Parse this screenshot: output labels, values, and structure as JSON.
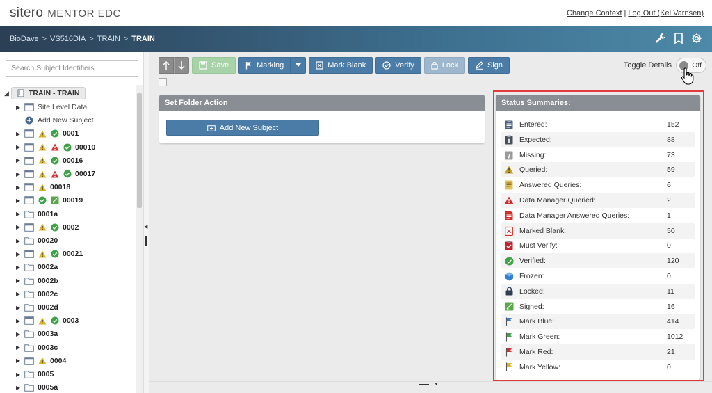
{
  "header": {
    "logo_text": "sitero",
    "logo_sub": "MENTOR EDC",
    "links": [
      "Change Context",
      "Log Out (Kel Varnsen)"
    ],
    "separator": "|"
  },
  "breadcrumb": {
    "items": [
      "BioDave",
      "VS516DIA",
      "TRAIN"
    ],
    "current": "TRAIN",
    "separator": ">"
  },
  "nav_icons": [
    "wrench-icon",
    "bookmark-icon",
    "gear-icon"
  ],
  "sidebar": {
    "search_placeholder": "Search Subject Identifiers",
    "root_label": "TRAIN - TRAIN",
    "items": [
      {
        "label": "Site Level Data",
        "icon": "page",
        "statuses": [],
        "bold": false,
        "caret": true
      },
      {
        "label": "Add New Subject",
        "icon": "plus",
        "statuses": [],
        "bold": false,
        "caret": false
      },
      {
        "label": "0001",
        "icon": "page",
        "statuses": [
          "warn",
          "ok"
        ],
        "bold": true,
        "caret": true
      },
      {
        "label": "00010",
        "icon": "page",
        "statuses": [
          "warn",
          "dm",
          "ok"
        ],
        "bold": true,
        "caret": true
      },
      {
        "label": "00016",
        "icon": "page",
        "statuses": [
          "warn",
          "ok"
        ],
        "bold": true,
        "caret": true
      },
      {
        "label": "00017",
        "icon": "page",
        "statuses": [
          "warn",
          "dm",
          "ok"
        ],
        "bold": true,
        "caret": true
      },
      {
        "label": "00018",
        "icon": "page",
        "statuses": [
          "warn"
        ],
        "bold": true,
        "caret": true
      },
      {
        "label": "00019",
        "icon": "page",
        "statuses": [
          "ok",
          "signed"
        ],
        "bold": true,
        "caret": true
      },
      {
        "label": "0001a",
        "icon": "folder",
        "statuses": [],
        "bold": true,
        "caret": true
      },
      {
        "label": "0002",
        "icon": "page",
        "statuses": [
          "warn",
          "ok"
        ],
        "bold": true,
        "caret": true
      },
      {
        "label": "00020",
        "icon": "folder",
        "statuses": [],
        "bold": true,
        "caret": true
      },
      {
        "label": "00021",
        "icon": "page",
        "statuses": [
          "warn",
          "ok"
        ],
        "bold": true,
        "caret": true
      },
      {
        "label": "0002a",
        "icon": "folder",
        "statuses": [],
        "bold": true,
        "caret": true
      },
      {
        "label": "0002b",
        "icon": "folder",
        "statuses": [],
        "bold": true,
        "caret": true
      },
      {
        "label": "0002c",
        "icon": "folder",
        "statuses": [],
        "bold": true,
        "caret": true
      },
      {
        "label": "0002d",
        "icon": "folder",
        "statuses": [],
        "bold": true,
        "caret": true
      },
      {
        "label": "0003",
        "icon": "page",
        "statuses": [
          "warn",
          "ok"
        ],
        "bold": true,
        "caret": true
      },
      {
        "label": "0003a",
        "icon": "folder",
        "statuses": [],
        "bold": true,
        "caret": true
      },
      {
        "label": "0003c",
        "icon": "folder",
        "statuses": [],
        "bold": true,
        "caret": true
      },
      {
        "label": "0004",
        "icon": "page",
        "statuses": [
          "warn"
        ],
        "bold": true,
        "caret": true
      },
      {
        "label": "0005",
        "icon": "folder",
        "statuses": [],
        "bold": true,
        "caret": true
      },
      {
        "label": "0005a",
        "icon": "folder",
        "statuses": [],
        "bold": true,
        "caret": true
      }
    ]
  },
  "toolbar": {
    "save": "Save",
    "marking": "Marking",
    "mark_blank": "Mark Blank",
    "verify": "Verify",
    "lock": "Lock",
    "sign": "Sign",
    "toggle_label": "Toggle Details",
    "toggle_state": "Off"
  },
  "folder_panel": {
    "title": "Set Folder Action",
    "button": "Add New Subject"
  },
  "status_panel": {
    "title": "Status Summaries:",
    "rows": [
      {
        "name": "Entered:",
        "value": "152",
        "icon": "entered"
      },
      {
        "name": "Expected:",
        "value": "88",
        "icon": "expected"
      },
      {
        "name": "Missing:",
        "value": "73",
        "icon": "missing"
      },
      {
        "name": "Queried:",
        "value": "59",
        "icon": "queried"
      },
      {
        "name": "Answered Queries:",
        "value": "6",
        "icon": "answered"
      },
      {
        "name": "Data Manager Queried:",
        "value": "2",
        "icon": "dmqueried"
      },
      {
        "name": "Data Manager Answered Queries:",
        "value": "1",
        "icon": "dmanswered"
      },
      {
        "name": "Marked Blank:",
        "value": "50",
        "icon": "blank"
      },
      {
        "name": "Must Verify:",
        "value": "0",
        "icon": "mustverify"
      },
      {
        "name": "Verified:",
        "value": "120",
        "icon": "verified"
      },
      {
        "name": "Frozen:",
        "value": "0",
        "icon": "frozen"
      },
      {
        "name": "Locked:",
        "value": "11",
        "icon": "locked"
      },
      {
        "name": "Signed:",
        "value": "16",
        "icon": "signed"
      },
      {
        "name": "Mark Blue:",
        "value": "414",
        "icon": "flag-blue"
      },
      {
        "name": "Mark Green:",
        "value": "1012",
        "icon": "flag-green"
      },
      {
        "name": "Mark Red:",
        "value": "21",
        "icon": "flag-red"
      },
      {
        "name": "Mark Yellow:",
        "value": "0",
        "icon": "flag-yellow"
      }
    ]
  },
  "colors": {
    "accent": "#4b7ca8",
    "highlight": "#e03a3a",
    "warn": "#d9b32a",
    "ok": "#3da346",
    "danger": "#d42b2b"
  }
}
